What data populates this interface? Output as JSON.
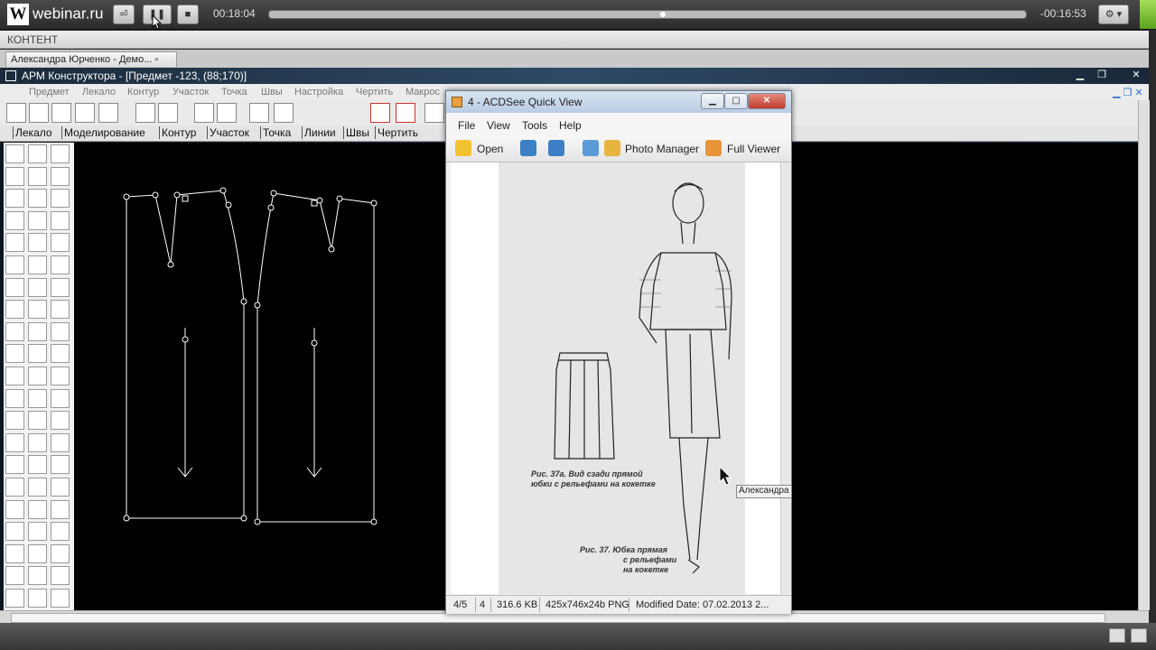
{
  "player": {
    "brand": "webinar.ru",
    "brand_letter": "W",
    "elapsed": "00:18:04",
    "remaining": "-00:16:53",
    "progress_fraction": 0.52
  },
  "content_bar": {
    "label": "КОНТЕНТ"
  },
  "doc_tab": {
    "label": "Александра Юрченко - Демо..."
  },
  "cad": {
    "title": "АРМ Конструктора - [Предмет -123,  (88;170)]",
    "menu": [
      "Предмет",
      "Лекало",
      "Контур",
      "Участок",
      "Точка",
      "Швы",
      "Настройка",
      "Чертить",
      "Макрос"
    ],
    "tabs": [
      "Лекало",
      "Моделирование",
      "Контур",
      "Участок",
      "Точка",
      "Линии",
      "Швы",
      "Чертить"
    ]
  },
  "acdsee": {
    "title": "4 - ACDSee Quick View",
    "menu": [
      "File",
      "View",
      "Tools",
      "Help"
    ],
    "toolbar": {
      "open": "Open",
      "photo_manager": "Photo Manager",
      "full_viewer": "Full Viewer"
    },
    "status": {
      "index": "4/5",
      "num": "4",
      "size": "316.6 KB",
      "dims": "425x746x24b PNG",
      "modified": "Modified Date: 07.02.2013 2..."
    },
    "captions": {
      "c1_line1": "Рис. 37а. Вид сзади прямой",
      "c1_line2": "юбки с рельефами на кокетке",
      "c2_line1": "Рис. 37. Юбка  прямая",
      "c2_line2": "с рельефами",
      "c2_line3": "на кокетке"
    }
  },
  "presenter_tag": "Александра",
  "colors": {
    "canvas": "#000000",
    "player_accent": "#7ac142"
  }
}
